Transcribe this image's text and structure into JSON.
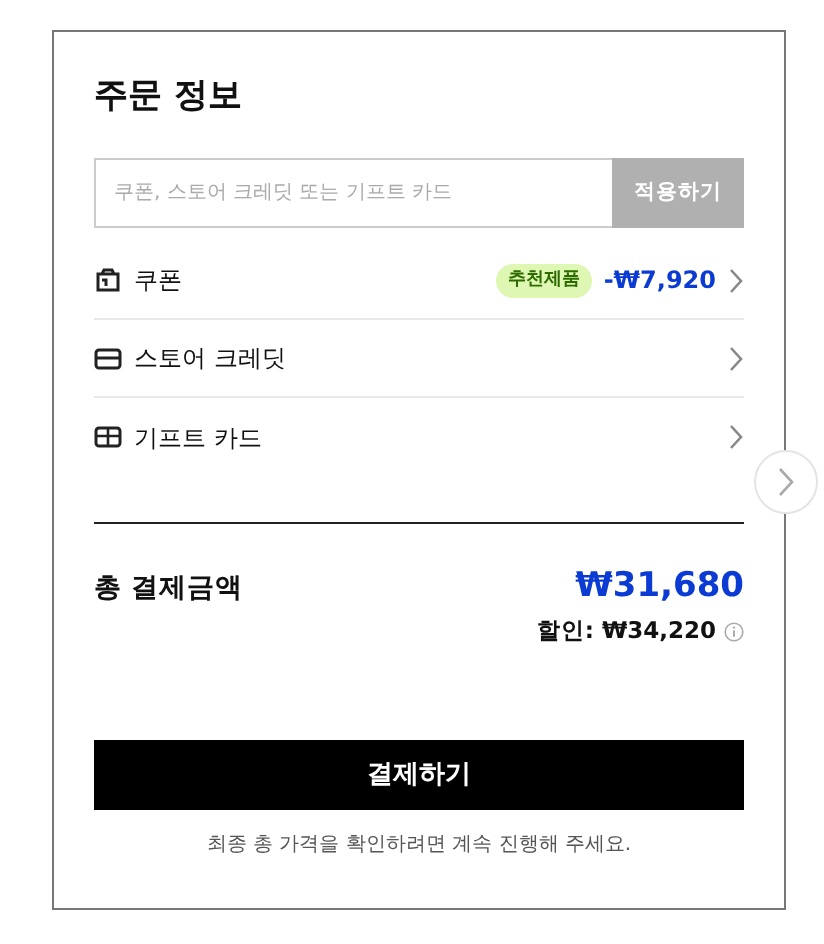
{
  "title": "주문 정보",
  "code_entry": {
    "placeholder": "쿠폰, 스토어 크레딧 또는 기프트 카드",
    "button": "적용하기",
    "disabled": true
  },
  "payment_options": [
    {
      "kind": "coupon",
      "label": "쿠폰",
      "badge": "추천제품",
      "amount": "-₩7,920"
    },
    {
      "kind": "credit",
      "label": "스토어 크레딧"
    },
    {
      "kind": "gift",
      "label": "기프트 카드"
    }
  ],
  "total": {
    "label": "총 결제금액",
    "amount": "₩31,680",
    "discount_label": "할인:",
    "discount_amount": "₩34,220"
  },
  "pay_button": "결제하기",
  "note": "최종 총 가격을 확인하려면 계속 진행해 주세요."
}
